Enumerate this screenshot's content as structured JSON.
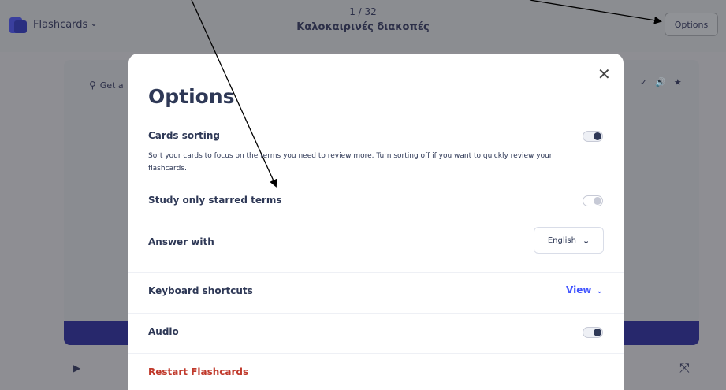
{
  "topbar": {
    "mode_label": "Flashcards",
    "counter": "1 / 32",
    "deck_title": "Καλοκαιρινές διακοπές",
    "options_button": "Options"
  },
  "card": {
    "hint": "Get a"
  },
  "modal": {
    "title": "Options",
    "cards_sorting": {
      "label": "Cards sorting",
      "description": "Sort your cards to focus on the terms you need to review more. Turn sorting off if you want to quickly review your flashcards.",
      "enabled": true
    },
    "starred": {
      "label": "Study only starred terms",
      "enabled": false
    },
    "answer_with": {
      "label": "Answer with",
      "value": "English"
    },
    "keyboard": {
      "label": "Keyboard shortcuts",
      "link": "View"
    },
    "audio": {
      "label": "Audio",
      "enabled": true
    },
    "restart": "Restart Flashcards"
  },
  "colors": {
    "accent": "#4255ff",
    "danger": "#c0392b",
    "overlay": "#8e8e93",
    "navy": "#27286c"
  }
}
